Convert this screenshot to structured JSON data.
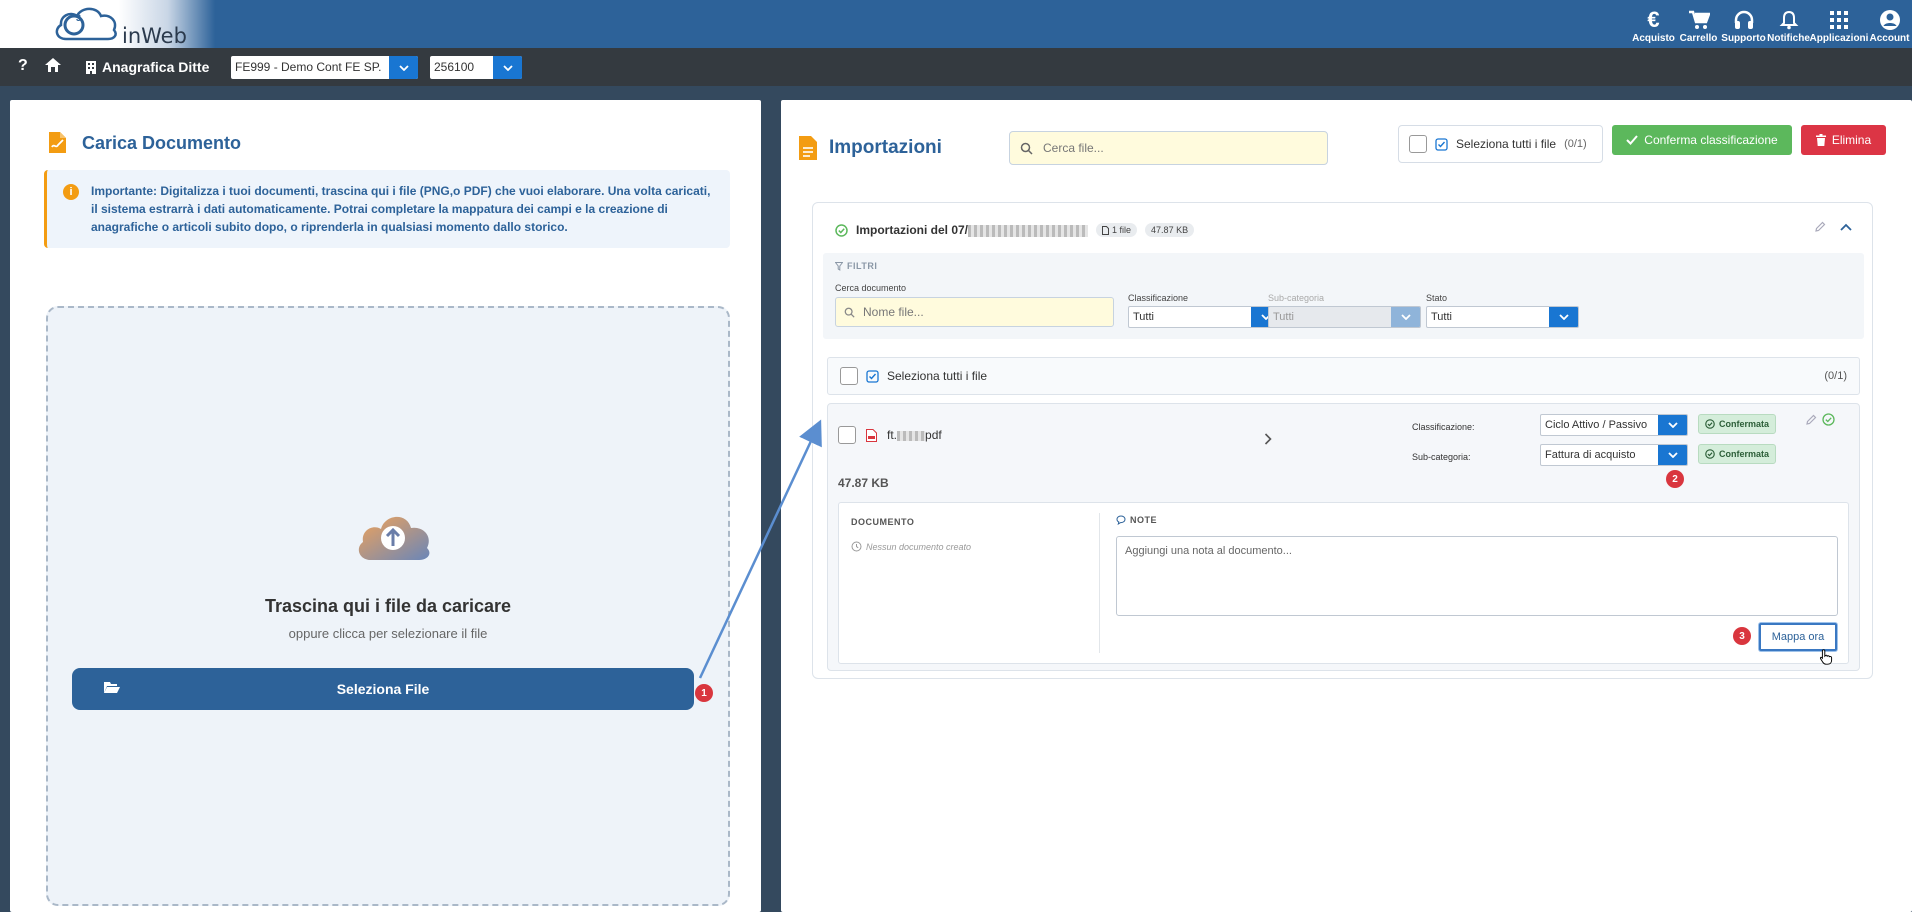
{
  "topbar": {
    "logo_text": "inWeb",
    "logo_mark": "G3",
    "actions": [
      {
        "icon": "euro-icon",
        "label": "Acquisto"
      },
      {
        "icon": "cart-icon",
        "label": "Carrello"
      },
      {
        "icon": "headset-icon",
        "label": "Supporto"
      },
      {
        "icon": "bell-icon",
        "label": "Notifiche"
      },
      {
        "icon": "grid-icon",
        "label": "Applicazioni"
      },
      {
        "icon": "user-icon",
        "label": "Account"
      }
    ]
  },
  "subbar": {
    "help": "?",
    "section": "Anagrafica Ditte",
    "company_select": "FE999 - Demo Cont FE SP.",
    "code_select": "256100"
  },
  "upload": {
    "title": "Carica Documento",
    "alert": "Importante: Digitalizza i tuoi documenti, trascina qui i file (PNG,o PDF) che vuoi elaborare. Una volta caricati, il sistema estrarrà i dati automaticamente. Potrai completare la mappatura dei campi e la creazione di anagrafiche o articoli subito dopo, o riprenderla in qualsiasi momento dallo storico.",
    "drop_title": "Trascina qui i file da caricare",
    "drop_sub": "oppure clicca per selezionare il file",
    "select_button": "Seleziona File"
  },
  "imports": {
    "title": "Importazioni",
    "search_placeholder": "Cerca file...",
    "select_all": "Seleziona tutti i file",
    "select_count": "(0/1)",
    "confirm_button": "Conferma classificazione",
    "delete_button": "Elimina",
    "group": {
      "title_prefix": "Importazioni del 07/",
      "files_pill": "1 file",
      "size_pill": "47.87 KB",
      "filters": {
        "title": "FILTRI",
        "search_label": "Cerca documento",
        "search_placeholder": "Nome file...",
        "class_label": "Classificazione",
        "class_value": "Tutti",
        "subcat_label": "Sub-categoria",
        "subcat_value": "Tutti",
        "state_label": "Stato",
        "state_value": "Tutti"
      },
      "select_all": "Seleziona tutti i file",
      "select_count": "(0/1)",
      "file": {
        "name_prefix": "ft.",
        "name_suffix": "pdf",
        "size": "47.87 KB",
        "class_label": "Classificazione:",
        "class_value": "Ciclo Attivo / Passivo",
        "class_status": "Confermata",
        "subcat_label": "Sub-categoria:",
        "subcat_value": "Fattura di acquisto",
        "subcat_status": "Confermata",
        "doc_title": "DOCUMENTO",
        "doc_empty": "Nessun documento creato",
        "note_title": "NOTE",
        "note_placeholder": "Aggiungi una nota al documento...",
        "map_button": "Mappa ora"
      }
    }
  },
  "annotations": [
    "1",
    "2",
    "3"
  ],
  "colors": {
    "brand": "#2d6299",
    "accent": "#1976d2",
    "success": "#5cb85c",
    "danger": "#dc3545",
    "warning": "#f39c12"
  }
}
